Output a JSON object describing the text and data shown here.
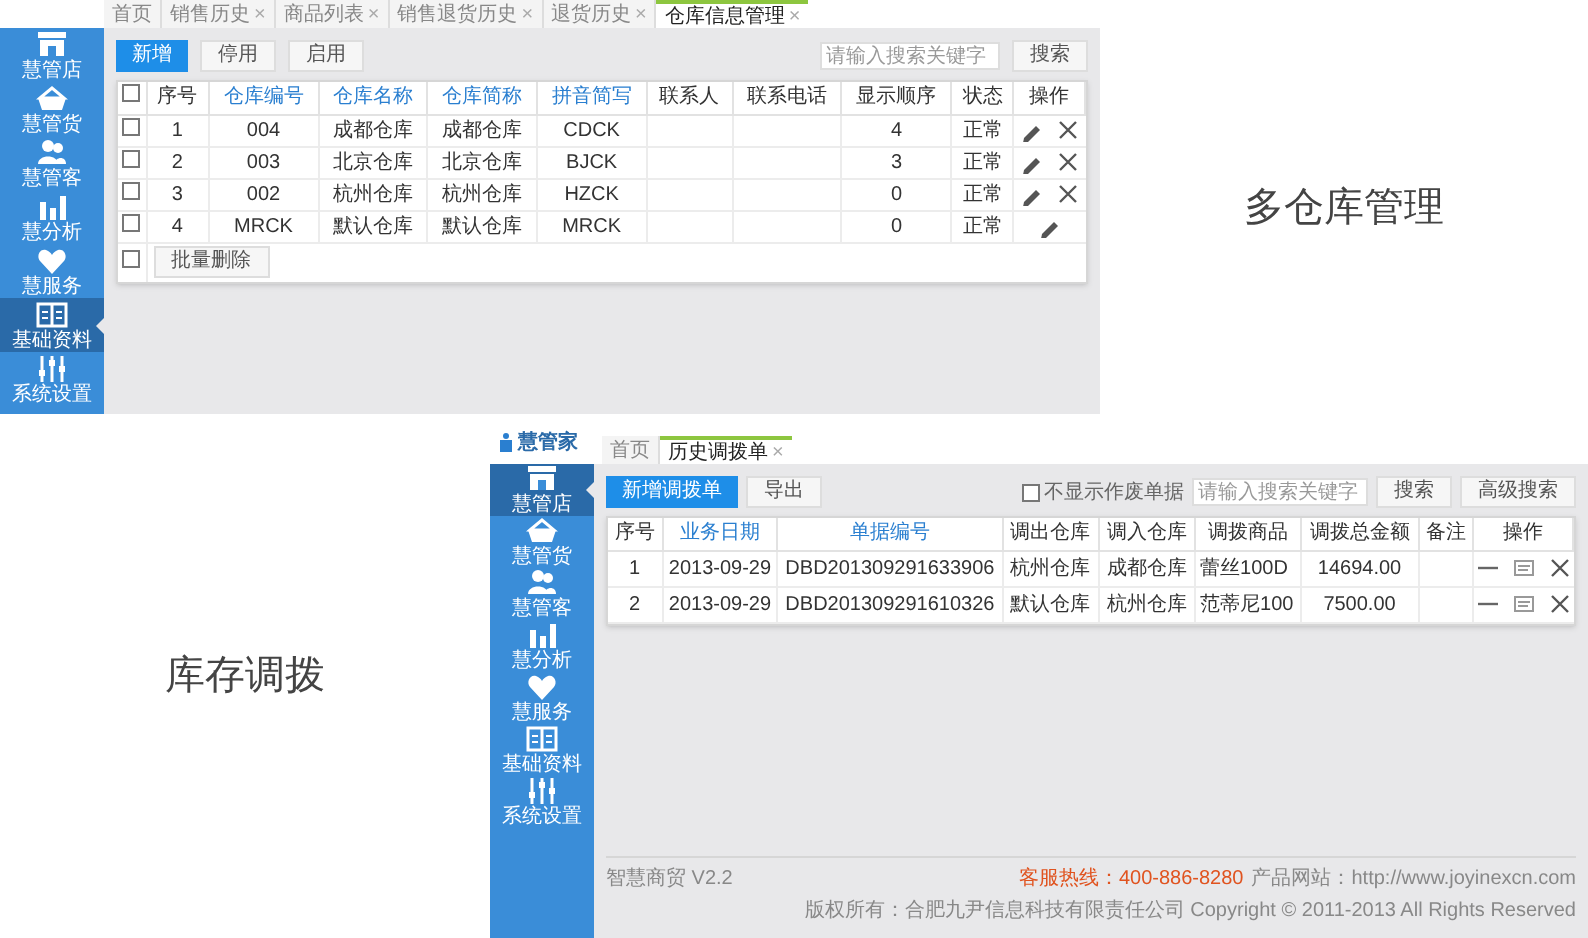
{
  "top_panel": {
    "tabs": [
      {
        "label": "首页",
        "selected": false
      },
      {
        "label": "销售历史",
        "close": "×",
        "selected": false
      },
      {
        "label": "商品列表",
        "close": "×",
        "selected": false
      },
      {
        "label": "销售退货历史",
        "close": "×",
        "selected": false
      },
      {
        "label": "退货历史",
        "close": "×",
        "selected": false
      },
      {
        "label": "仓库信息管理",
        "close": "×",
        "selected": true
      }
    ],
    "sidebar": [
      {
        "label": "慧管店",
        "selected": false
      },
      {
        "label": "慧管货",
        "selected": false
      },
      {
        "label": "慧管客",
        "selected": false
      },
      {
        "label": "慧分析",
        "selected": false
      },
      {
        "label": "慧服务",
        "selected": false
      },
      {
        "label": "基础资料",
        "selected": true
      },
      {
        "label": "系统设置",
        "selected": false
      }
    ],
    "buttons": [
      {
        "label": "新增",
        "kind": "primary"
      },
      {
        "label": "停用",
        "kind": "default"
      },
      {
        "label": "启用",
        "kind": "default"
      }
    ],
    "search": {
      "placeholder": "请输入搜索关键字"
    },
    "search_button": "搜索",
    "table": {
      "select_all": false,
      "columns": [
        {
          "label": "序号",
          "sortable": false
        },
        {
          "label": "仓库编号",
          "sortable": true
        },
        {
          "label": "仓库名称",
          "sortable": true
        },
        {
          "label": "仓库简称",
          "sortable": true
        },
        {
          "label": "拼音简写",
          "sortable": true
        },
        {
          "label": "联系人",
          "sortable": false
        },
        {
          "label": "联系电话",
          "sortable": false
        },
        {
          "label": "显示顺序",
          "sortable": false
        },
        {
          "label": "状态",
          "sortable": false
        },
        {
          "label": "操作",
          "sortable": false
        }
      ],
      "rows": [
        {
          "checked": false,
          "cells": [
            "1",
            "004",
            "成都仓库",
            "成都仓库",
            "CDCK",
            "",
            "",
            "4",
            "正常"
          ],
          "actions": [
            {
              "kind": "edit"
            },
            {
              "kind": "delete"
            }
          ]
        },
        {
          "checked": false,
          "cells": [
            "2",
            "003",
            "北京仓库",
            "北京仓库",
            "BJCK",
            "",
            "",
            "3",
            "正常"
          ],
          "actions": [
            {
              "kind": "edit"
            },
            {
              "kind": "delete"
            }
          ]
        },
        {
          "checked": false,
          "cells": [
            "3",
            "002",
            "杭州仓库",
            "杭州仓库",
            "HZCK",
            "",
            "",
            "0",
            "正常"
          ],
          "actions": [
            {
              "kind": "edit"
            },
            {
              "kind": "delete"
            }
          ]
        },
        {
          "checked": false,
          "cells": [
            "4",
            "MRCK",
            "默认仓库",
            "默认仓库",
            "MRCK",
            "",
            "",
            "0",
            "正常"
          ],
          "actions": [
            {
              "kind": "edit"
            }
          ]
        }
      ]
    },
    "footer_checked": false,
    "footer_button": "批量删除"
  },
  "top_caption": "多仓库管理",
  "bottom_caption": "库存调拨",
  "bottom_panel": {
    "logo": "慧管家",
    "tabs": [
      {
        "label": "首页",
        "selected": false
      },
      {
        "label": "历史调拨单",
        "close": "×",
        "selected": true
      }
    ],
    "sidebar": [
      {
        "label": "慧管店",
        "selected": true
      },
      {
        "label": "慧管货",
        "selected": false
      },
      {
        "label": "慧管客",
        "selected": false
      },
      {
        "label": "慧分析",
        "selected": false
      },
      {
        "label": "慧服务",
        "selected": false
      },
      {
        "label": "基础资料",
        "selected": false
      },
      {
        "label": "系统设置",
        "selected": false
      }
    ],
    "buttons": [
      {
        "label": "新增调拨单",
        "kind": "primary"
      },
      {
        "label": "导出",
        "kind": "default"
      }
    ],
    "hide_void": {
      "label": "不显示作废单据",
      "checked": false
    },
    "search": {
      "placeholder": "请输入搜索关键字"
    },
    "search_buttons": [
      "搜索",
      "高级搜索"
    ],
    "table": {
      "columns": [
        {
          "label": "序号",
          "sortable": false
        },
        {
          "label": "业务日期",
          "sortable": true
        },
        {
          "label": "单据编号",
          "sortable": true
        },
        {
          "label": "调出仓库",
          "sortable": false
        },
        {
          "label": "调入仓库",
          "sortable": false
        },
        {
          "label": "调拨商品",
          "sortable": false
        },
        {
          "label": "调拨总金额",
          "sortable": false
        },
        {
          "label": "备注",
          "sortable": false
        },
        {
          "label": "操作",
          "sortable": false
        }
      ],
      "rows": [
        {
          "cells": [
            "1",
            "2013-09-29",
            "DBD201309291633906",
            "杭州仓库",
            "成都仓库",
            "蕾丝100D",
            "14694.00",
            ""
          ],
          "actions": [
            {
              "kind": "minus"
            },
            {
              "kind": "note"
            },
            {
              "kind": "delete"
            }
          ]
        },
        {
          "cells": [
            "2",
            "2013-09-29",
            "DBD201309291610326",
            "默认仓库",
            "杭州仓库",
            "范蒂尼100",
            "7500.00",
            ""
          ],
          "actions": [
            {
              "kind": "minus"
            },
            {
              "kind": "note"
            },
            {
              "kind": "delete"
            }
          ]
        }
      ]
    },
    "version": "智慧商贸 V2.2",
    "hotline_label": "客服热线：400-886-8280",
    "website": "产品网站：http://www.joyinexcn.com",
    "copyright": "版权所有：合肥九尹信息科技有限责任公司 Copyright © 2011-2013 All Rights Reserved"
  }
}
